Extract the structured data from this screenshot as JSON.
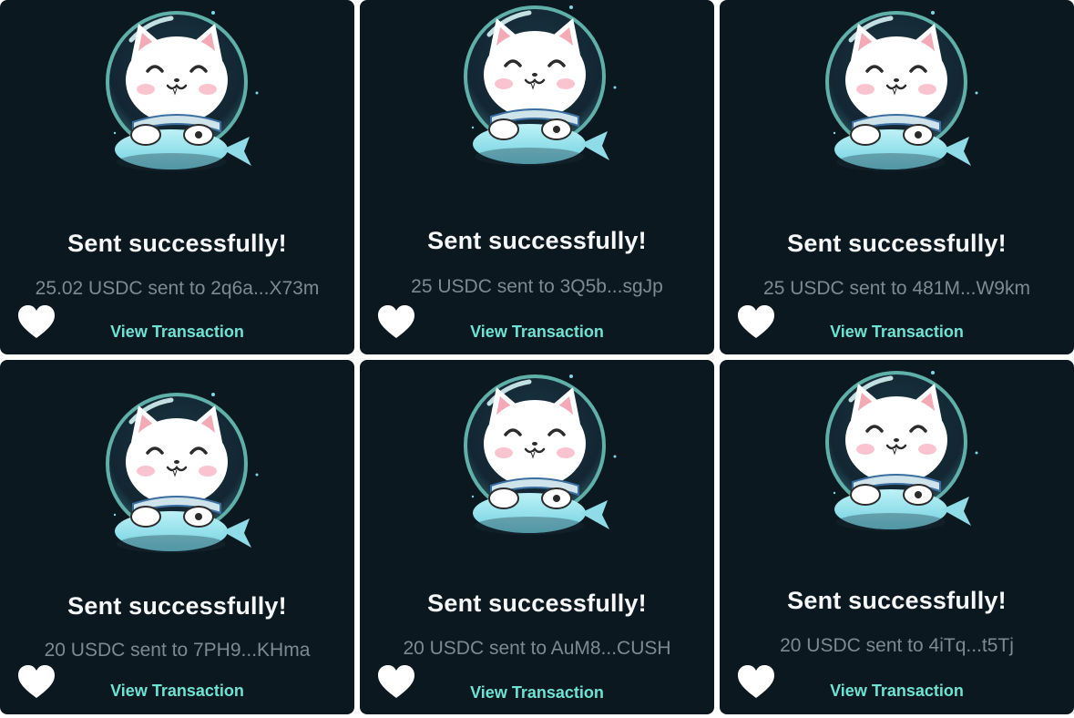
{
  "cards": [
    {
      "title": "Sent successfully!",
      "message": "25.02 USDC sent to 2q6a...X73m",
      "link": "View Transaction",
      "heart_icon": "heart-icon"
    },
    {
      "title": "Sent successfully!",
      "message": "25 USDC sent to 3Q5b...sgJp",
      "link": "View Transaction",
      "heart_icon": "heart-icon"
    },
    {
      "title": "Sent successfully!",
      "message": "25 USDC sent to 481M...W9km",
      "link": "View Transaction",
      "heart_icon": "heart-icon"
    },
    {
      "title": "Sent successfully!",
      "message": "20 USDC sent to 7PH9...KHma",
      "link": "View Transaction",
      "heart_icon": "heart-icon"
    },
    {
      "title": "Sent successfully!",
      "message": "20 USDC sent to AuM8...CUSH",
      "link": "View Transaction",
      "heart_icon": "heart-icon"
    },
    {
      "title": "Sent successfully!",
      "message": "20 USDC sent to 4iTq...t5Tj",
      "link": "View Transaction",
      "heart_icon": "heart-icon"
    }
  ],
  "colors": {
    "card_bg": "#0c1820",
    "link": "#6fe3d3",
    "subtext": "#7d8a92",
    "title": "#f5f7f8"
  }
}
